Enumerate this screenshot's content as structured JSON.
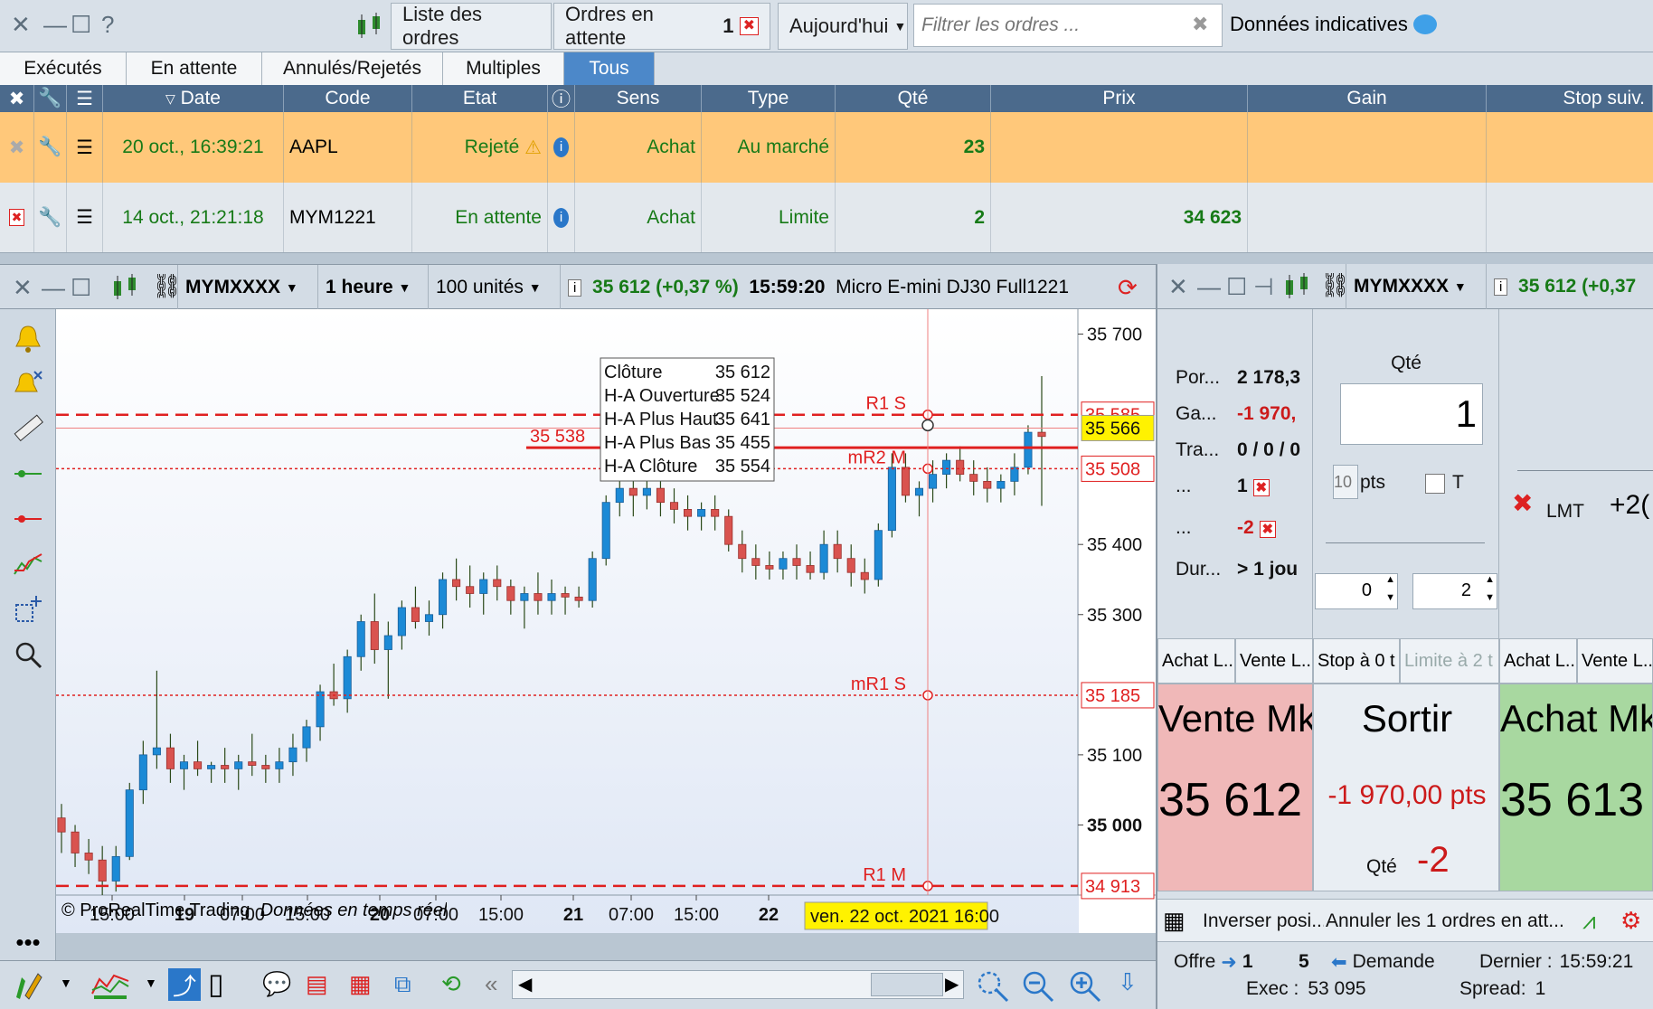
{
  "orders_window": {
    "list_button": "Liste des ordres",
    "pending_button": "Ordres en attente",
    "pending_count": "1",
    "period_select": "Aujourd'hui",
    "filter_placeholder": "Filtrer les ordres ...",
    "indicative_label": "Données indicatives"
  },
  "tabs": [
    {
      "label": "Exécutés",
      "active": false
    },
    {
      "label": "En attente",
      "active": false
    },
    {
      "label": "Annulés/Rejetés",
      "active": false
    },
    {
      "label": "Multiples",
      "active": false
    },
    {
      "label": "Tous",
      "active": true
    }
  ],
  "table": {
    "columns": [
      "Date",
      "Code",
      "Etat",
      "Sens",
      "Type",
      "Qté",
      "Prix",
      "Gain",
      "Stop suiv."
    ],
    "rows": [
      {
        "date": "20 oct., 16:39:21",
        "code": "AAPL",
        "etat": "Rejeté",
        "sens": "Achat",
        "type": "Au marché",
        "qte": "23",
        "prix": "",
        "gain": "",
        "stop": ""
      },
      {
        "date": "14 oct., 21:21:18",
        "code": "MYM1221",
        "etat": "En attente",
        "sens": "Achat",
        "type": "Limite",
        "qte": "2",
        "prix": "34 623",
        "gain": "",
        "stop": ""
      }
    ]
  },
  "chart_window": {
    "symbol": "MYMXXXX",
    "timeframe": "1 heure",
    "units": "100 unités",
    "price_change": "35 612 (+0,37 %)",
    "time": "15:59:20",
    "instrument": "Micro E-mini DJ30 Full1221",
    "copyright": "© ProRealTime Trading",
    "realtime": "Données en temps réel",
    "current_date": "ven. 22 oct. 2021 16:00"
  },
  "chart_data": {
    "type": "candlestick",
    "ylim": [
      34900,
      35720
    ],
    "y_ticks": [
      "35 700",
      "35 400",
      "35 300",
      "35 100",
      "35 000"
    ],
    "x_ticks": [
      "15:00",
      "19",
      "07:00",
      "15:00",
      "20",
      "07:00",
      "15:00",
      "21",
      "07:00",
      "15:00",
      "22"
    ],
    "levels": [
      {
        "name": "R1 S",
        "value": "35 585",
        "y": 35585,
        "style": "dashed",
        "color": "#e02020"
      },
      {
        "name": "mR2 M",
        "value": "35 508",
        "y": 35508,
        "style": "dotted",
        "color": "#e02020"
      },
      {
        "name": "mR1 S",
        "value": "35 185",
        "y": 35185,
        "style": "dotted",
        "color": "#e02020"
      },
      {
        "name": "R1 M",
        "value": "34 913",
        "y": 34913,
        "style": "dashed",
        "color": "#e02020"
      }
    ],
    "order_line": {
      "label": "35 538",
      "y": 35538
    },
    "current_price": {
      "label": "35 566",
      "y": 35566
    },
    "tooltip": [
      {
        "k": "Clôture",
        "v": "35 612"
      },
      {
        "k": "H-A Ouverture",
        "v": "35 524"
      },
      {
        "k": "H-A Plus Haut",
        "v": "35 641"
      },
      {
        "k": "H-A Plus Bas",
        "v": "35 455"
      },
      {
        "k": "H-A Clôture",
        "v": "35 554"
      }
    ],
    "candles": [
      [
        35010,
        35030,
        34960,
        34990
      ],
      [
        34990,
        35000,
        34940,
        34960
      ],
      [
        34960,
        34980,
        34930,
        34950
      ],
      [
        34950,
        34970,
        34900,
        34920
      ],
      [
        34920,
        34970,
        34905,
        34955
      ],
      [
        34955,
        35060,
        34950,
        35050
      ],
      [
        35050,
        35120,
        35030,
        35100
      ],
      [
        35100,
        35220,
        35080,
        35110
      ],
      [
        35110,
        35130,
        35060,
        35080
      ],
      [
        35080,
        35100,
        35050,
        35090
      ],
      [
        35090,
        35120,
        35070,
        35080
      ],
      [
        35080,
        35090,
        35060,
        35085
      ],
      [
        35085,
        35110,
        35060,
        35080
      ],
      [
        35080,
        35100,
        35050,
        35090
      ],
      [
        35090,
        35130,
        35070,
        35085
      ],
      [
        35085,
        35100,
        35060,
        35080
      ],
      [
        35080,
        35110,
        35060,
        35090
      ],
      [
        35090,
        35130,
        35070,
        35110
      ],
      [
        35110,
        35150,
        35090,
        35140
      ],
      [
        35140,
        35200,
        35120,
        35190
      ],
      [
        35190,
        35230,
        35170,
        35180
      ],
      [
        35180,
        35250,
        35160,
        35240
      ],
      [
        35240,
        35300,
        35220,
        35290
      ],
      [
        35290,
        35330,
        35230,
        35250
      ],
      [
        35250,
        35290,
        35180,
        35270
      ],
      [
        35270,
        35320,
        35250,
        35310
      ],
      [
        35310,
        35340,
        35280,
        35290
      ],
      [
        35290,
        35320,
        35270,
        35300
      ],
      [
        35300,
        35360,
        35280,
        35350
      ],
      [
        35350,
        35380,
        35320,
        35340
      ],
      [
        35340,
        35370,
        35310,
        35330
      ],
      [
        35330,
        35360,
        35300,
        35350
      ],
      [
        35350,
        35370,
        35320,
        35340
      ],
      [
        35340,
        35350,
        35300,
        35320
      ],
      [
        35320,
        35340,
        35280,
        35330
      ],
      [
        35330,
        35360,
        35300,
        35320
      ],
      [
        35320,
        35350,
        35300,
        35330
      ],
      [
        35330,
        35340,
        35300,
        35325
      ],
      [
        35325,
        35340,
        35310,
        35320
      ],
      [
        35320,
        35390,
        35310,
        35380
      ],
      [
        35380,
        35470,
        35370,
        35460
      ],
      [
        35460,
        35540,
        35440,
        35480
      ],
      [
        35480,
        35510,
        35440,
        35470
      ],
      [
        35470,
        35500,
        35450,
        35480
      ],
      [
        35480,
        35500,
        35440,
        35460
      ],
      [
        35460,
        35480,
        35430,
        35450
      ],
      [
        35450,
        35470,
        35420,
        35440
      ],
      [
        35440,
        35460,
        35420,
        35450
      ],
      [
        35450,
        35470,
        35420,
        35440
      ],
      [
        35440,
        35450,
        35390,
        35400
      ],
      [
        35400,
        35420,
        35360,
        35380
      ],
      [
        35380,
        35400,
        35350,
        35370
      ],
      [
        35370,
        35390,
        35350,
        35365
      ],
      [
        35365,
        35390,
        35350,
        35380
      ],
      [
        35380,
        35400,
        35350,
        35370
      ],
      [
        35370,
        35390,
        35350,
        35360
      ],
      [
        35360,
        35420,
        35350,
        35400
      ],
      [
        35400,
        35420,
        35360,
        35380
      ],
      [
        35380,
        35400,
        35340,
        35360
      ],
      [
        35360,
        35380,
        35330,
        35350
      ],
      [
        35350,
        35430,
        35340,
        35420
      ],
      [
        35420,
        35530,
        35410,
        35510
      ],
      [
        35510,
        35530,
        35460,
        35470
      ],
      [
        35470,
        35490,
        35440,
        35480
      ],
      [
        35480,
        35520,
        35460,
        35500
      ],
      [
        35500,
        35530,
        35480,
        35520
      ],
      [
        35520,
        35540,
        35490,
        35500
      ],
      [
        35500,
        35520,
        35470,
        35490
      ],
      [
        35490,
        35510,
        35460,
        35480
      ],
      [
        35480,
        35500,
        35460,
        35490
      ],
      [
        35490,
        35530,
        35470,
        35510
      ],
      [
        35510,
        35570,
        35500,
        35560
      ],
      [
        35560,
        35640,
        35455,
        35554
      ]
    ]
  },
  "right_panel": {
    "symbol": "MYMXXXX",
    "price_change": "35 612 (+0,37",
    "info": [
      {
        "k": "Por...",
        "v": "2 178,3",
        "red": false
      },
      {
        "k": "Ga...",
        "v": "-1 970,",
        "red": true
      },
      {
        "k": "Tra...",
        "v": "0 / 0 / 0",
        "red": false
      },
      {
        "k": "...",
        "v": "1",
        "red": false
      },
      {
        "k": "...",
        "v": "-2",
        "red": true
      },
      {
        "k": "Dur...",
        "v": "> 1 jou",
        "red": false
      }
    ],
    "qty_label": "Qté",
    "qty_value": "1",
    "pts_placeholder": "10",
    "pts_label": "pts",
    "t_label": "T",
    "lmt_label": "LMT",
    "lmt_value": "+2(",
    "spin_left": "0",
    "spin_right": "2",
    "buttons": [
      "Achat L...",
      "Vente L...",
      "Stop à 0 t",
      "Limite à 2 t",
      "Achat L...",
      "Vente L..."
    ],
    "sell_label": "Vente Mk",
    "sell_price": "35 612",
    "exit_label": "Sortir",
    "exit_pts": "-1 970,00 pts",
    "exit_qty_label": "Qté",
    "exit_qty": "-2",
    "buy_label": "Achat Mk",
    "buy_price": "35 613",
    "reverse_label": "Inverser posi...",
    "cancel_label": "Annuler les 1 ordres en att...",
    "offer_label": "Offre",
    "offer_value": "1",
    "mid_value": "5",
    "demand_label": "Demande",
    "last_label": "Dernier :",
    "last_time": "15:59:21",
    "exec_label": "Exec :",
    "exec_value": "53 095",
    "spread_label": "Spread:",
    "spread_value": "1"
  },
  "colors": {
    "accent": "#4c88c9",
    "row_rejected": "#ffc87a",
    "row_pending": "#e3e8ed",
    "bull": "#1c8ad6",
    "bear": "#d9534f",
    "sell_bg": "#f0b8b8",
    "buy_bg": "#a8d8a0"
  }
}
